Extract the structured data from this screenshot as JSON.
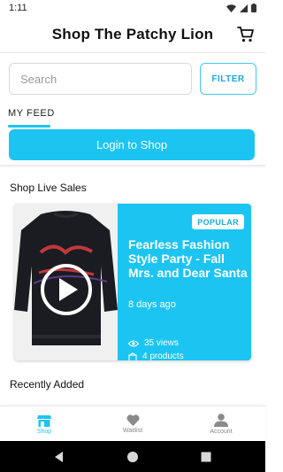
{
  "status_bar": {
    "time": "1:11"
  },
  "header": {
    "title": "Shop The Patchy Lion",
    "cart_icon": "cart-icon"
  },
  "search": {
    "placeholder": "Search",
    "filter_label": "FILTER"
  },
  "feed": {
    "label": "MY FEED"
  },
  "login": {
    "label": "Login to Shop"
  },
  "live_sales": {
    "heading": "Shop Live Sales",
    "card": {
      "badge": "POPULAR",
      "title": "Fearless Fashion Style Party - Fall Mrs. and Dear Santa",
      "age": "8 days ago",
      "views": "35 views",
      "products": "4 products"
    }
  },
  "recent": {
    "heading": "Recently Added"
  },
  "bottom_nav": {
    "items": [
      {
        "label": "Shop",
        "icon": "store-icon"
      },
      {
        "label": "Waitlist",
        "icon": "heart-icon"
      },
      {
        "label": "Account",
        "icon": "person-icon"
      }
    ]
  },
  "colors": {
    "accent": "#1cc4f2",
    "accent_text": "#1aa9dd"
  }
}
